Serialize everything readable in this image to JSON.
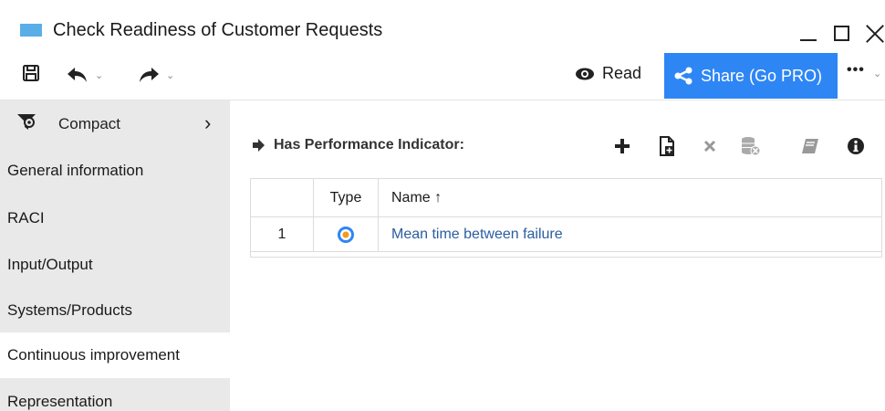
{
  "window": {
    "title": "Check Readiness of Customer Requests"
  },
  "toolbar": {
    "read_label": "Read",
    "share_label": "Share (Go PRO)",
    "more_label": "•••"
  },
  "sidebar": {
    "compact_label": "Compact",
    "items": [
      {
        "label": "General information"
      },
      {
        "label": "RACI"
      },
      {
        "label": "Input/Output"
      },
      {
        "label": "Systems/Products"
      },
      {
        "label": "Continuous improvement"
      },
      {
        "label": "Representation"
      }
    ]
  },
  "section": {
    "title": "Has Performance Indicator:"
  },
  "table": {
    "headers": {
      "type": "Type",
      "name": "Name ↑"
    },
    "rows": [
      {
        "num": "1",
        "name": "Mean time between failure"
      }
    ]
  },
  "colors": {
    "accent": "#2e86f5",
    "link": "#2a5d9f",
    "sidebar_bg": "#e9e9e9"
  }
}
